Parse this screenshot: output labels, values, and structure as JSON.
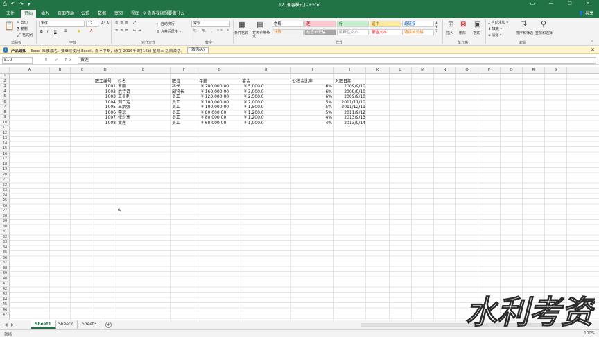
{
  "window": {
    "title": "12 [兼容模式] - Excel",
    "quick_access": "⎙ ↶ ↷ ▾",
    "controls": "▭ — ☐ ✕"
  },
  "tabs": [
    "文件",
    "开始",
    "插入",
    "页面布局",
    "公式",
    "数据",
    "审阅",
    "视图"
  ],
  "active_tab": "开始",
  "tell_me": "告诉我你想要做什么",
  "share": "共享",
  "ribbon": {
    "clipboard": {
      "cut": "剪切",
      "copy": "复制",
      "painter": "格式刷",
      "label": "剪贴板"
    },
    "font": {
      "name": "宋体",
      "size": "12",
      "bold": "B",
      "italic": "I",
      "underline": "U",
      "label": "字体"
    },
    "alignment": {
      "wrap": "自动换行",
      "merge": "合并后居中",
      "label": "对齐方式"
    },
    "number": {
      "format": "常规",
      "label": "数字"
    },
    "styles": {
      "conditional": "条件格式",
      "as_table": "套用表格格式",
      "cells": [
        {
          "text": "常规",
          "bg": "#ffffff",
          "fg": "#000000"
        },
        {
          "text": "差",
          "bg": "#ffc7ce",
          "fg": "#9c0006"
        },
        {
          "text": "好",
          "bg": "#c6efce",
          "fg": "#006100"
        },
        {
          "text": "适中",
          "bg": "#ffeb9c",
          "fg": "#9c5700"
        },
        {
          "text": "超链接",
          "bg": "#ffffff",
          "fg": "#0563c1"
        },
        {
          "text": "计算",
          "bg": "#f2f2f2",
          "fg": "#fa7d00"
        },
        {
          "text": "检查单元格",
          "bg": "#a5a5a5",
          "fg": "#ffffff"
        },
        {
          "text": "解释性文本",
          "bg": "#ffffff",
          "fg": "#7f7f7f"
        },
        {
          "text": "警告文本",
          "bg": "#ffffff",
          "fg": "#ff0000"
        },
        {
          "text": "链接单元格",
          "bg": "#ffffff",
          "fg": "#fa7d00"
        }
      ],
      "label": "样式"
    },
    "cells_group": {
      "insert": "插入",
      "delete": "删除",
      "format": "格式",
      "label": "单元格"
    },
    "editing": {
      "autosum": "自动求和",
      "fill": "填充",
      "clear": "清除",
      "sort": "排序和筛选",
      "find": "查找和选择",
      "label": "编辑"
    }
  },
  "infobar": {
    "label": "产品通知",
    "message": "Excel 未被激活。要继续使用 Excel，而不中断，请在 2016年3月16日 星期三 之前激活。",
    "button": "激活(A)",
    "close": "✕"
  },
  "formula_bar": {
    "name_box": "E10",
    "icons": "✕ ✓ fx",
    "value": "黄莲"
  },
  "columns": [
    "A",
    "B",
    "C",
    "D",
    "E",
    "F",
    "G",
    "H",
    "I",
    "J",
    "K",
    "L",
    "M",
    "N",
    "O",
    "P",
    "Q",
    "R",
    "S"
  ],
  "row_count": 47,
  "headers": {
    "id": "职工编号",
    "name": "姓名",
    "pos": "职位",
    "salary": "年薪",
    "bonus": "奖金",
    "fund": "公积金比率",
    "date": "入职日期"
  },
  "employees": [
    {
      "id": "1001",
      "name": "章丽",
      "pos": "科长",
      "salary": "¥    200,000.00",
      "bonus": "¥      5,000.0",
      "fund": "6%",
      "date": "2009/9/10"
    },
    {
      "id": "1002",
      "name": "洪诗诗",
      "pos": "副科长",
      "salary": "¥    160,000.00",
      "bonus": "¥      3,000.0",
      "fund": "6%",
      "date": "2009/9/10"
    },
    {
      "id": "1003",
      "name": "王灵利",
      "pos": "员工",
      "salary": "¥    120,000.00",
      "bonus": "¥      2,500.0",
      "fund": "6%",
      "date": "2009/9/10"
    },
    {
      "id": "1004",
      "name": "刘二定",
      "pos": "员工",
      "salary": "¥    100,000.00",
      "bonus": "¥      2,000.0",
      "fund": "5%",
      "date": "2011/11/10"
    },
    {
      "id": "1005",
      "name": "王炳强",
      "pos": "员工",
      "salary": "¥    100,000.00",
      "bonus": "¥      1,500.0",
      "fund": "5%",
      "date": "2011/12/11"
    },
    {
      "id": "1006",
      "name": "李琼",
      "pos": "员工",
      "salary": "¥     80,000.00",
      "bonus": "¥      1,200.0",
      "fund": "5%",
      "date": "2011/9/12"
    },
    {
      "id": "1007",
      "name": "张少东",
      "pos": "员工",
      "salary": "¥     80,000.00",
      "bonus": "¥      1,200.0",
      "fund": "4%",
      "date": "2013/9/13"
    },
    {
      "id": "1008",
      "name": "黄莲",
      "pos": "员工",
      "salary": "¥     60,000.00",
      "bonus": "¥      1,000.0",
      "fund": "4%",
      "date": "2013/9/14"
    }
  ],
  "sheets": [
    "Sheet1",
    "Sheet2",
    "Sheet3"
  ],
  "active_sheet": "Sheet1",
  "status": {
    "ready": "就绪",
    "zoom": "100%"
  },
  "watermark": "水利考资",
  "colors": {
    "excel_green": "#217346",
    "info_bg": "#fff4ce"
  }
}
